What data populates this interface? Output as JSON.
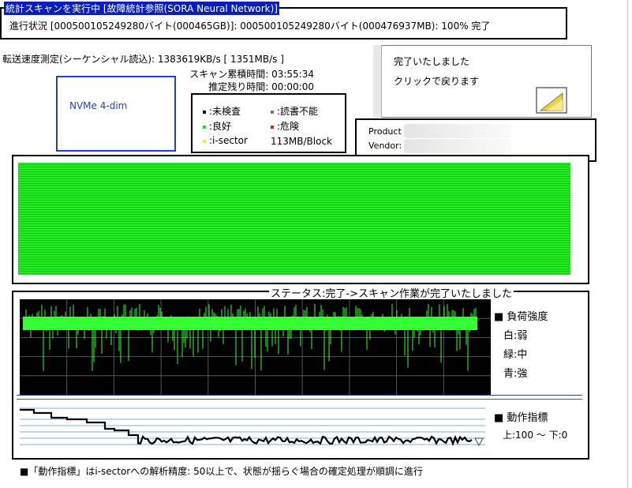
{
  "header": {
    "title": "統計スキャンを実行中 [故障統計参照(SORA Neural Network)]",
    "progress": "進行状況 [000500105249280バイト(000465GB)]: 000500105249280バイト(000476937MB): 100% 完了"
  },
  "stats": {
    "transfer_speed": "転送速度測定(シーケンシャル読込): 1383619KB/s [ 1351MB/s ]",
    "scan_elapsed": "スキャン累積時間: 03:55:34",
    "remaining": "推定残り時間: 00:00:00"
  },
  "device": {
    "label": "NVMe 4-dim"
  },
  "legend": {
    "unchecked": ":未検査",
    "unreadable": ":読書不能",
    "good": ":良好",
    "danger": ":危険",
    "isector": ":i-sector",
    "block_size": "113MB/Block",
    "colors": {
      "unchecked": "#000000",
      "unreadable": "#6666dd",
      "good": "#22dd22",
      "danger": "#dd2222",
      "isector": "#eeee22"
    }
  },
  "done_panel": {
    "line1": "完了いたしました",
    "line2": "クリックで戻ります",
    "icon": "notepad-icon"
  },
  "product": {
    "product_label": "Product",
    "vendor_label": "Vendor:"
  },
  "scan_map": {
    "color": "#22ee22"
  },
  "status": {
    "label": "ステータス:完了->スキャン作業が完了いたしました",
    "load_title": "■ 負荷強度",
    "load_white": "白:弱",
    "load_green": "緑:中",
    "load_blue": "青:強",
    "action_title": "■ 動作指標",
    "action_range": "上:100 ～ 下:0"
  },
  "footer": "■「動作指標」はi-sectorへの解析精度: 50以上で、状態が揺らぐ場合の確定処理が順調に進行"
}
